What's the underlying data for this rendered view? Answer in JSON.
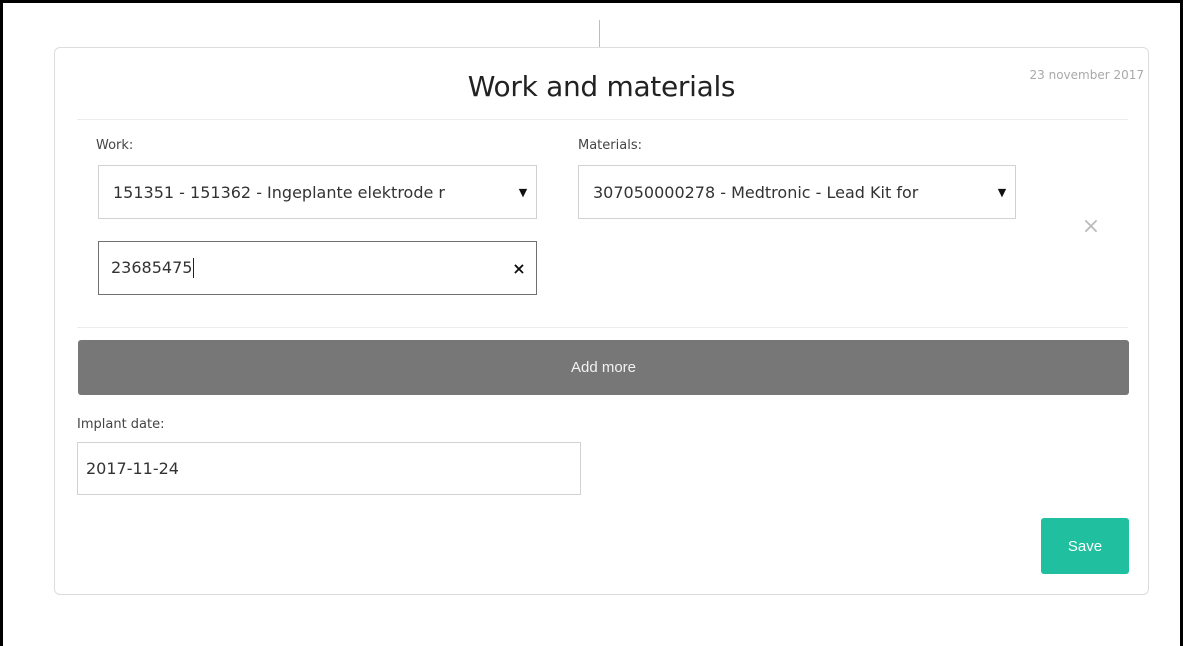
{
  "card": {
    "title": "Work and materials",
    "date": "23 november 2017"
  },
  "work": {
    "label": "Work:",
    "selected": "151351 - 151362 - Ingeplante elektrode r",
    "caret_icon": "caret-down-icon"
  },
  "materials": {
    "label": "Materials:",
    "selected": "307050000278 - Medtronic - Lead Kit for",
    "caret_icon": "caret-down-icon"
  },
  "serial_input": {
    "value": "23685475",
    "clear_symbol": "×"
  },
  "remove_row_symbol": "×",
  "add_more": {
    "label": "Add more",
    "color": "#777777"
  },
  "implant_date": {
    "label": "Implant date:",
    "value": "2017-11-24"
  },
  "save": {
    "label": "Save",
    "color": "#1fbf9f"
  }
}
